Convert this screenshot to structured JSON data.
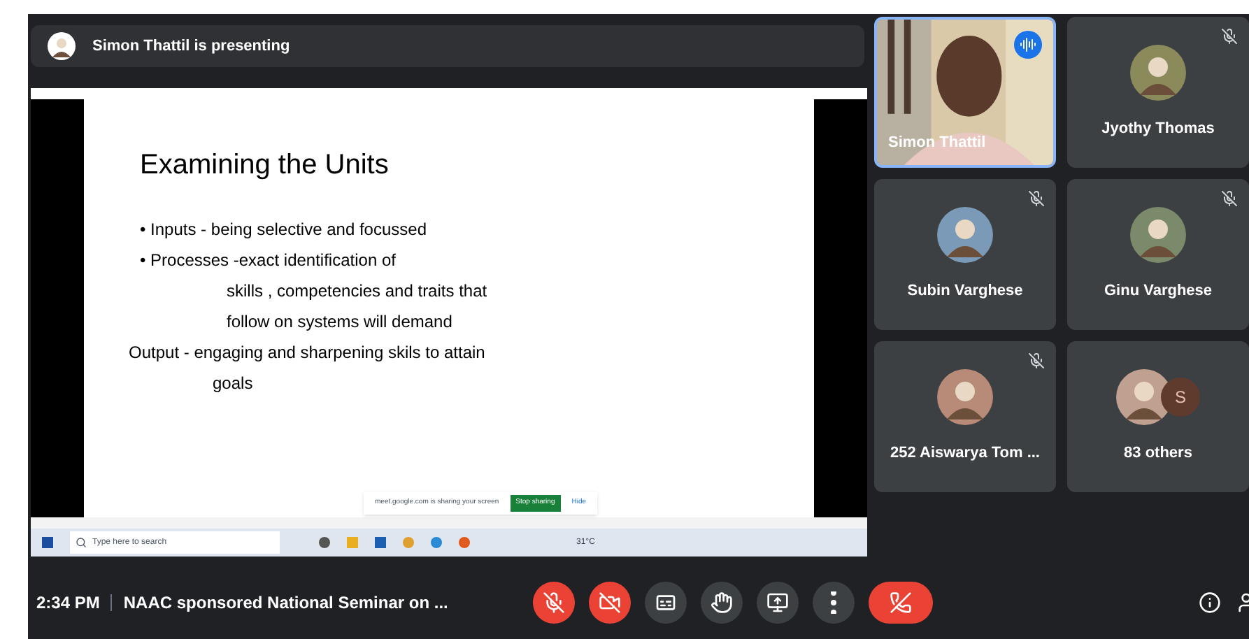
{
  "presenting_banner": {
    "text": "Simon Thattil is presenting"
  },
  "shared_screen": {
    "slide": {
      "title": "Examining the Units",
      "lines": [
        {
          "text": "• Inputs - being selective and focussed",
          "kind": "bullet"
        },
        {
          "text": "• Processes -exact identification of",
          "kind": "bullet"
        },
        {
          "text": "skills , competencies and traits that",
          "kind": "indent"
        },
        {
          "text": "follow on systems will demand",
          "kind": "indent"
        },
        {
          "text": "Output - engaging and sharpening skils to attain",
          "kind": "plain"
        },
        {
          "text": "goals",
          "kind": "indent2"
        }
      ]
    },
    "share_bar": {
      "message": "meet.google.com is sharing your screen",
      "buttons": [
        {
          "label": "Stop sharing",
          "kind": "primary"
        },
        {
          "label": "Hide",
          "kind": "link"
        }
      ]
    },
    "taskbar": {
      "search_placeholder": "Type here to search",
      "temperature": "31°C"
    }
  },
  "tiles": [
    {
      "name": "Simon Thattil",
      "kind": "video",
      "speaking": true,
      "muted": false
    },
    {
      "name": "Jyothy Thomas",
      "kind": "avatar",
      "speaking": false,
      "muted": true
    },
    {
      "name": "Subin Varghese",
      "kind": "avatar",
      "speaking": false,
      "muted": true
    },
    {
      "name": "Ginu Varghese",
      "kind": "avatar",
      "speaking": false,
      "muted": true
    },
    {
      "name": "252 Aiswarya Tom ...",
      "kind": "avatar",
      "speaking": false,
      "muted": true
    },
    {
      "name": "83 others",
      "kind": "others",
      "initial": "S",
      "speaking": false,
      "muted": false
    }
  ],
  "bottom_bar": {
    "time": "2:34 PM",
    "meeting_title": "NAAC sponsored National Seminar on ...",
    "controls": [
      {
        "kind": "mic",
        "on": false
      },
      {
        "kind": "camera",
        "on": false
      },
      {
        "kind": "captions",
        "on": false
      },
      {
        "kind": "hand"
      },
      {
        "kind": "present"
      },
      {
        "kind": "more"
      },
      {
        "kind": "end"
      }
    ]
  }
}
